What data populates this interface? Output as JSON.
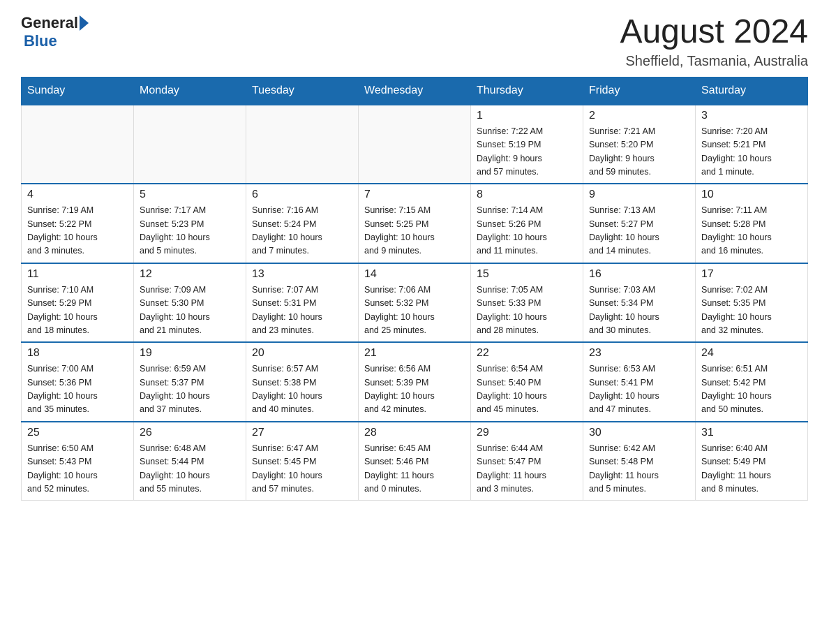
{
  "header": {
    "month_year": "August 2024",
    "location": "Sheffield, Tasmania, Australia",
    "logo_general": "General",
    "logo_blue": "Blue"
  },
  "weekdays": [
    "Sunday",
    "Monday",
    "Tuesday",
    "Wednesday",
    "Thursday",
    "Friday",
    "Saturday"
  ],
  "weeks": [
    [
      {
        "day": "",
        "info": ""
      },
      {
        "day": "",
        "info": ""
      },
      {
        "day": "",
        "info": ""
      },
      {
        "day": "",
        "info": ""
      },
      {
        "day": "1",
        "info": "Sunrise: 7:22 AM\nSunset: 5:19 PM\nDaylight: 9 hours\nand 57 minutes."
      },
      {
        "day": "2",
        "info": "Sunrise: 7:21 AM\nSunset: 5:20 PM\nDaylight: 9 hours\nand 59 minutes."
      },
      {
        "day": "3",
        "info": "Sunrise: 7:20 AM\nSunset: 5:21 PM\nDaylight: 10 hours\nand 1 minute."
      }
    ],
    [
      {
        "day": "4",
        "info": "Sunrise: 7:19 AM\nSunset: 5:22 PM\nDaylight: 10 hours\nand 3 minutes."
      },
      {
        "day": "5",
        "info": "Sunrise: 7:17 AM\nSunset: 5:23 PM\nDaylight: 10 hours\nand 5 minutes."
      },
      {
        "day": "6",
        "info": "Sunrise: 7:16 AM\nSunset: 5:24 PM\nDaylight: 10 hours\nand 7 minutes."
      },
      {
        "day": "7",
        "info": "Sunrise: 7:15 AM\nSunset: 5:25 PM\nDaylight: 10 hours\nand 9 minutes."
      },
      {
        "day": "8",
        "info": "Sunrise: 7:14 AM\nSunset: 5:26 PM\nDaylight: 10 hours\nand 11 minutes."
      },
      {
        "day": "9",
        "info": "Sunrise: 7:13 AM\nSunset: 5:27 PM\nDaylight: 10 hours\nand 14 minutes."
      },
      {
        "day": "10",
        "info": "Sunrise: 7:11 AM\nSunset: 5:28 PM\nDaylight: 10 hours\nand 16 minutes."
      }
    ],
    [
      {
        "day": "11",
        "info": "Sunrise: 7:10 AM\nSunset: 5:29 PM\nDaylight: 10 hours\nand 18 minutes."
      },
      {
        "day": "12",
        "info": "Sunrise: 7:09 AM\nSunset: 5:30 PM\nDaylight: 10 hours\nand 21 minutes."
      },
      {
        "day": "13",
        "info": "Sunrise: 7:07 AM\nSunset: 5:31 PM\nDaylight: 10 hours\nand 23 minutes."
      },
      {
        "day": "14",
        "info": "Sunrise: 7:06 AM\nSunset: 5:32 PM\nDaylight: 10 hours\nand 25 minutes."
      },
      {
        "day": "15",
        "info": "Sunrise: 7:05 AM\nSunset: 5:33 PM\nDaylight: 10 hours\nand 28 minutes."
      },
      {
        "day": "16",
        "info": "Sunrise: 7:03 AM\nSunset: 5:34 PM\nDaylight: 10 hours\nand 30 minutes."
      },
      {
        "day": "17",
        "info": "Sunrise: 7:02 AM\nSunset: 5:35 PM\nDaylight: 10 hours\nand 32 minutes."
      }
    ],
    [
      {
        "day": "18",
        "info": "Sunrise: 7:00 AM\nSunset: 5:36 PM\nDaylight: 10 hours\nand 35 minutes."
      },
      {
        "day": "19",
        "info": "Sunrise: 6:59 AM\nSunset: 5:37 PM\nDaylight: 10 hours\nand 37 minutes."
      },
      {
        "day": "20",
        "info": "Sunrise: 6:57 AM\nSunset: 5:38 PM\nDaylight: 10 hours\nand 40 minutes."
      },
      {
        "day": "21",
        "info": "Sunrise: 6:56 AM\nSunset: 5:39 PM\nDaylight: 10 hours\nand 42 minutes."
      },
      {
        "day": "22",
        "info": "Sunrise: 6:54 AM\nSunset: 5:40 PM\nDaylight: 10 hours\nand 45 minutes."
      },
      {
        "day": "23",
        "info": "Sunrise: 6:53 AM\nSunset: 5:41 PM\nDaylight: 10 hours\nand 47 minutes."
      },
      {
        "day": "24",
        "info": "Sunrise: 6:51 AM\nSunset: 5:42 PM\nDaylight: 10 hours\nand 50 minutes."
      }
    ],
    [
      {
        "day": "25",
        "info": "Sunrise: 6:50 AM\nSunset: 5:43 PM\nDaylight: 10 hours\nand 52 minutes."
      },
      {
        "day": "26",
        "info": "Sunrise: 6:48 AM\nSunset: 5:44 PM\nDaylight: 10 hours\nand 55 minutes."
      },
      {
        "day": "27",
        "info": "Sunrise: 6:47 AM\nSunset: 5:45 PM\nDaylight: 10 hours\nand 57 minutes."
      },
      {
        "day": "28",
        "info": "Sunrise: 6:45 AM\nSunset: 5:46 PM\nDaylight: 11 hours\nand 0 minutes."
      },
      {
        "day": "29",
        "info": "Sunrise: 6:44 AM\nSunset: 5:47 PM\nDaylight: 11 hours\nand 3 minutes."
      },
      {
        "day": "30",
        "info": "Sunrise: 6:42 AM\nSunset: 5:48 PM\nDaylight: 11 hours\nand 5 minutes."
      },
      {
        "day": "31",
        "info": "Sunrise: 6:40 AM\nSunset: 5:49 PM\nDaylight: 11 hours\nand 8 minutes."
      }
    ]
  ]
}
